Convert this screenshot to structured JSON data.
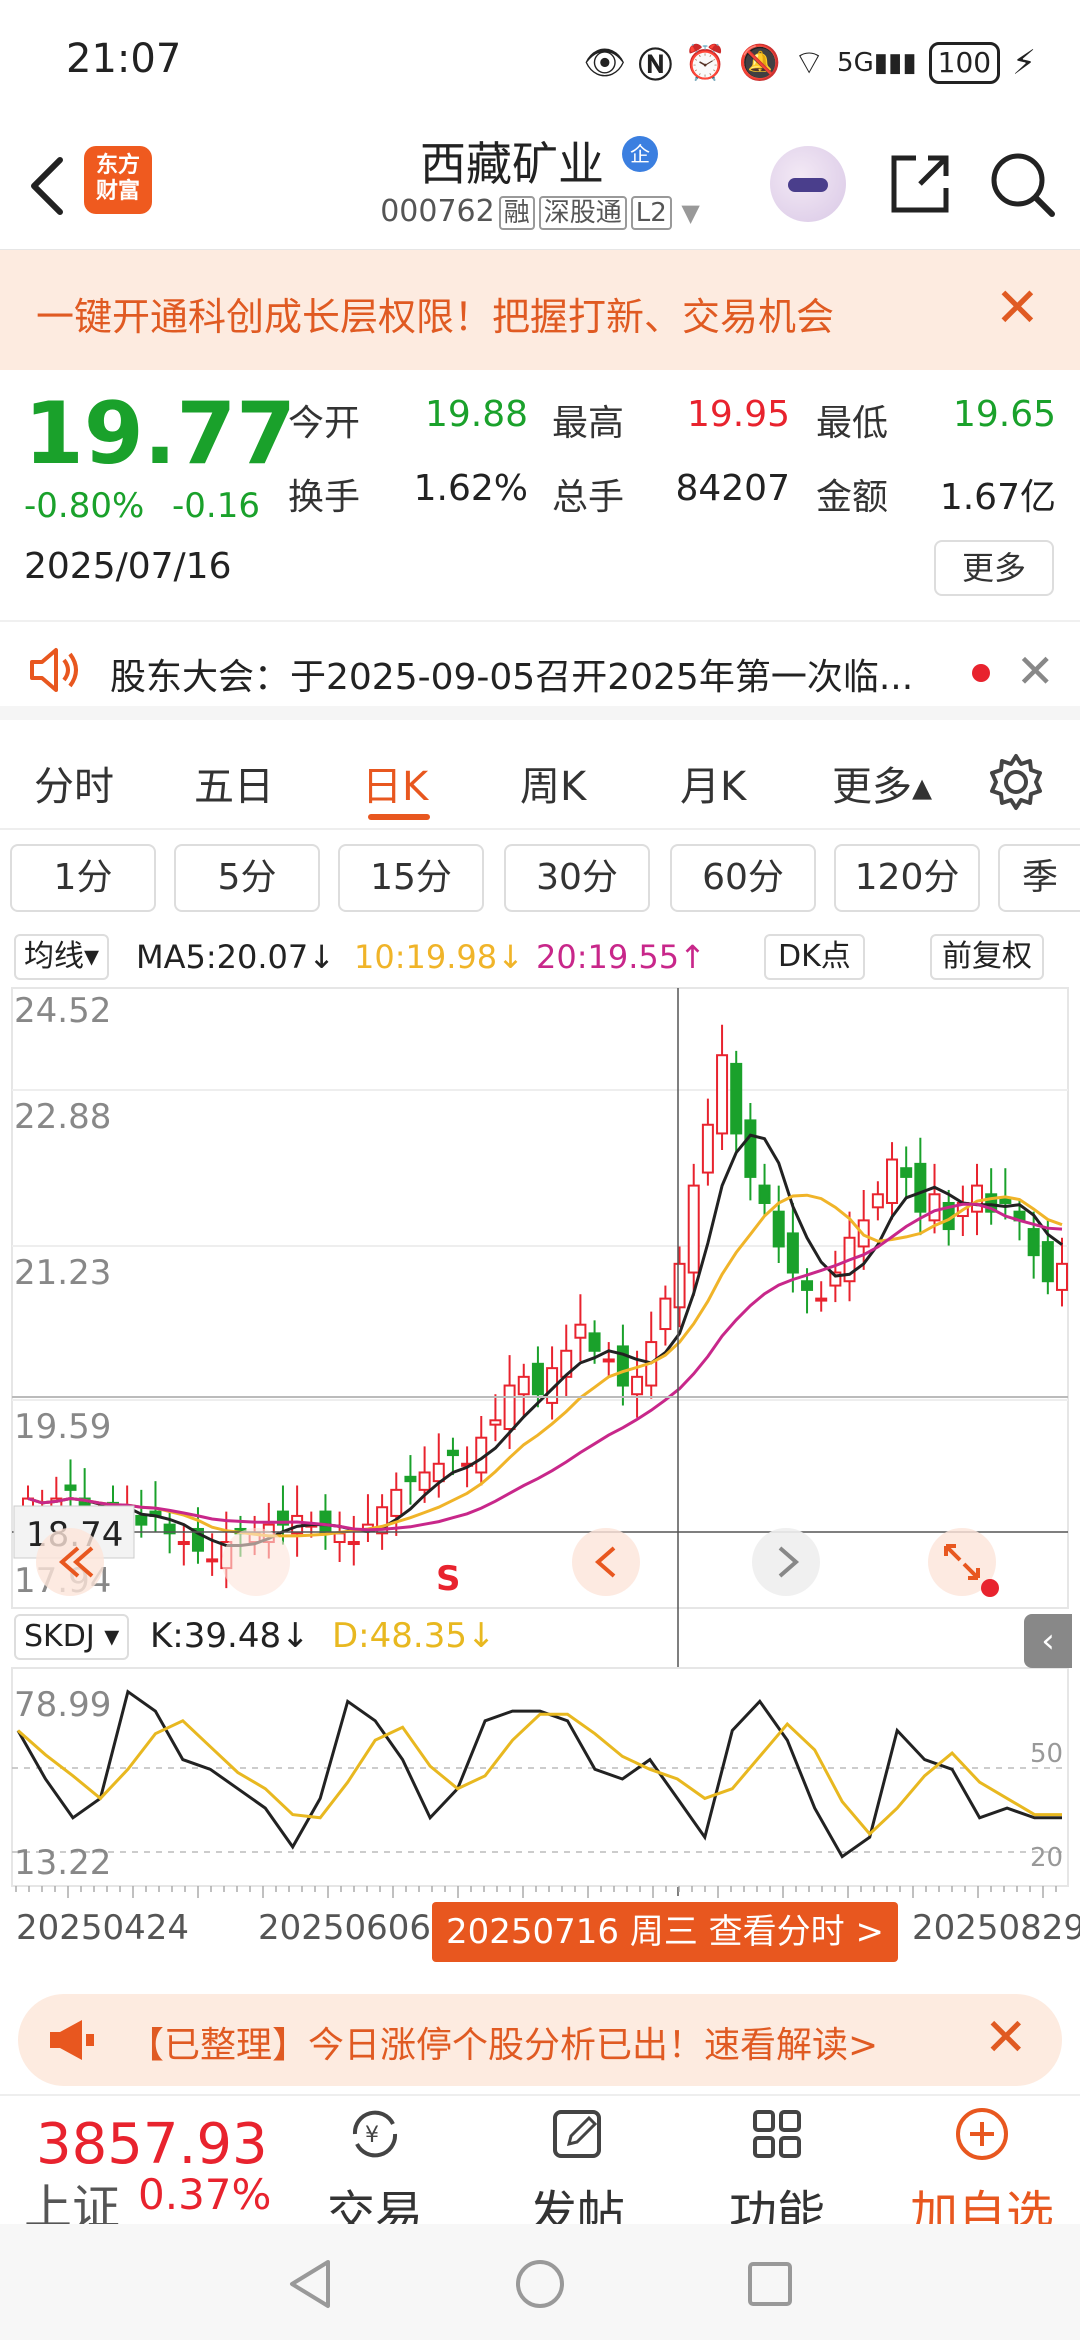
{
  "status_bar": {
    "time": "21:07",
    "battery": "100",
    "icons": [
      "eye-icon",
      "nfc-icon",
      "alarm-icon",
      "mute-icon",
      "wifi-icon",
      "signal-5g-icon",
      "battery-icon",
      "charging-icon"
    ]
  },
  "header": {
    "logo_line1": "东方",
    "logo_line2": "财富",
    "stock_name": "西藏矿业",
    "badge": "企",
    "stock_code": "000762",
    "tags": [
      "融",
      "深股通",
      "L2"
    ]
  },
  "promo": {
    "text": "一键开通科创成长层权限！把握打新、交易机会",
    "close": "✕"
  },
  "quote": {
    "price": "19.77",
    "change_pct": "-0.80%",
    "change_abs": "-0.16",
    "date": "2025/07/16",
    "fields": [
      {
        "label": "今开",
        "value": "19.88",
        "color": "green"
      },
      {
        "label": "最高",
        "value": "19.95",
        "color": "red"
      },
      {
        "label": "最低",
        "value": "19.65",
        "color": "green"
      },
      {
        "label": "换手",
        "value": "1.62%",
        "color": "black"
      },
      {
        "label": "总手",
        "value": "84207",
        "color": "black"
      },
      {
        "label": "金额",
        "value": "1.67亿",
        "color": "black"
      }
    ],
    "more_label": "更多"
  },
  "announcement": {
    "text": "股东大会：于2025-09-05召开2025年第一次临...",
    "close": "✕"
  },
  "period_tabs": [
    "分时",
    "五日",
    "日K",
    "周K",
    "月K",
    "更多▴"
  ],
  "active_tab": "日K",
  "minute_buttons": [
    "1分",
    "5分",
    "15分",
    "30分",
    "60分",
    "120分",
    "季"
  ],
  "ma_row": {
    "selector": "均线▾",
    "ma5": "MA5:20.07↓",
    "ma10": "10:19.98↓",
    "ma20": "20:19.55↑",
    "dk": "DK点",
    "fq": "前复权"
  },
  "chart_data": {
    "type": "candlestick",
    "y_labels": [
      "24.52",
      "22.88",
      "21.23",
      "19.59",
      "17.94"
    ],
    "ylim": [
      17.94,
      24.52
    ],
    "crosshair_value": "18.74",
    "buy_sell_marker": "S",
    "indicator": {
      "name": "SKDJ",
      "k_label": "K:39.48↓",
      "d_label": "D:48.35↓",
      "y_labels": [
        "78.99",
        "13.22"
      ],
      "ref_levels": [
        "50",
        "20"
      ]
    },
    "x_labels": [
      "20250424",
      "20250606",
      "20250829"
    ],
    "selected_date_label": "20250716 周三 查看分时 >",
    "colors": {
      "up": "#e8232e",
      "down": "#1aa12b",
      "ma5": "#222222",
      "ma10": "#f0b429",
      "ma20": "#c8278a",
      "k": "#222222",
      "d": "#e8b820"
    }
  },
  "notice": {
    "text": "【已整理】今日涨停个股分析已出！速看解读>",
    "close": "✕"
  },
  "bottom_bar": {
    "index_value": "3857.93",
    "index_name": "上证",
    "index_pct": "0.37%",
    "nav": [
      {
        "label": "交易",
        "icon": "trade-icon"
      },
      {
        "label": "发帖",
        "icon": "post-icon"
      },
      {
        "label": "功能",
        "icon": "apps-icon"
      },
      {
        "label": "加自选",
        "icon": "add-favorite-icon"
      }
    ]
  }
}
